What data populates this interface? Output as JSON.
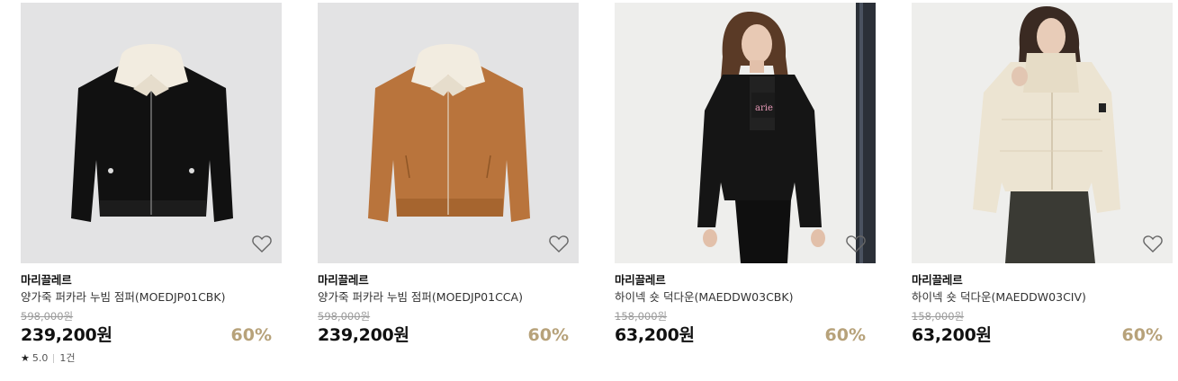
{
  "products": [
    {
      "brand": "마리끌레르",
      "name": "양가죽 퍼카라 누빔 점퍼(MOEDJP01CBK)",
      "original_price": "598,000원",
      "price": "239,200원",
      "discount": "60%",
      "image": "black-leather-jacket-shearling-collar",
      "rating": "5.0",
      "review_count": "1건"
    },
    {
      "brand": "마리끌레르",
      "name": "양가죽 퍼카라 누빔 점퍼(MOEDJP01CCA)",
      "original_price": "598,000원",
      "price": "239,200원",
      "discount": "60%",
      "image": "camel-leather-jacket-shearling-collar"
    },
    {
      "brand": "마리끌레르",
      "name": "하이넥 숏 덕다운(MAEDDW03CBK)",
      "original_price": "158,000원",
      "price": "63,200원",
      "discount": "60%",
      "image": "model-black-short-down-jacket"
    },
    {
      "brand": "마리끌레르",
      "name": "하이넥 숏 덕다운(MAEDDW03CIV)",
      "original_price": "158,000원",
      "price": "63,200원",
      "discount": "60%",
      "image": "model-ivory-short-down-jacket"
    }
  ],
  "icons": {
    "wishlist": "heart-outline-icon",
    "rating": "star-icon"
  },
  "colors": {
    "discount": "#b7a27a",
    "image_bg": "#e3e3e4"
  }
}
